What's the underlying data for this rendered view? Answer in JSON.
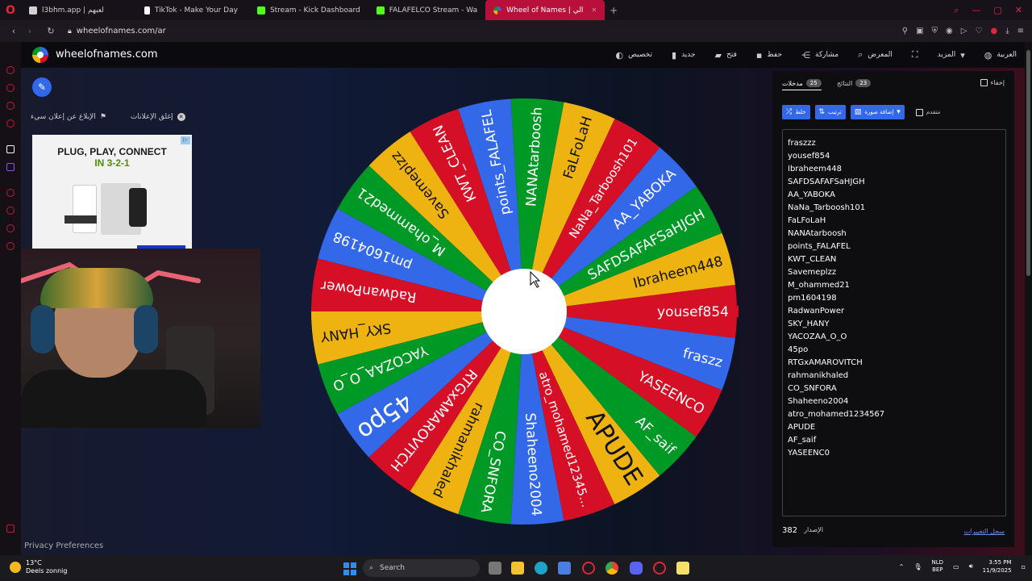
{
  "browser": {
    "tabs": [
      {
        "title": "l3bhm.app | لعبهم",
        "icon_color": "#d1d1d1",
        "active": false
      },
      {
        "title": "TikTok - Make Your Day",
        "icon_color": "#ffffff",
        "active": false
      },
      {
        "title": "Stream - Kick Dashboard",
        "icon_color": "#53fc18",
        "active": false
      },
      {
        "title": "FALAFELCO Stream - Wa",
        "icon_color": "#53fc18",
        "active": false
      },
      {
        "title": "Wheel of Names | الي",
        "icon_color": "#ffffff",
        "active": true
      }
    ],
    "url": "wheelofnames.com/ar"
  },
  "site": {
    "name": "wheelofnames.com",
    "menu": [
      {
        "label": "العربية",
        "icon": "globe-icon"
      },
      {
        "label": "المزيد",
        "icon": "chevron-down-icon"
      },
      {
        "label": "",
        "icon": "fullscreen-icon"
      },
      {
        "label": "المعرض",
        "icon": "search-icon"
      },
      {
        "label": "مشاركة",
        "icon": "share-icon"
      },
      {
        "label": "حفظ",
        "icon": "save-icon"
      },
      {
        "label": "فتح",
        "icon": "folder-icon"
      },
      {
        "label": "جديد",
        "icon": "file-icon"
      },
      {
        "label": "تخصيص",
        "icon": "palette-icon"
      }
    ],
    "ad_report": "الإبلاغ عن إعلان سيء",
    "ad_close": "إغلق الإعلانات",
    "ad_line1": "PLUG, PLAY, CONNECT",
    "ad_line2": "IN 3-2-1",
    "privacy": "Privacy Preferences"
  },
  "wheel": {
    "colors": [
      "#3369e8",
      "#d50f25",
      "#eeb211",
      "#009925"
    ],
    "pointer_color": "#d50f25",
    "segments": [
      "yousef854",
      "Ibraheem448",
      "SAFDSAFAFSaHJGH",
      "AA_YABOKA",
      "NaNa_Tarboosh101",
      "FaLFoLaH",
      "NANAtarboosh",
      "points_FALAFEL",
      "KWT_CLEAN",
      "Savemeplzz",
      "M_ohammed21",
      "pm1604198",
      "RadwanPower",
      "SKY_HANY",
      "YACOZAA_O_O",
      "45po",
      "RTGxAMAROVITCH",
      "rahmanikhaled",
      "CO_SNFORA",
      "Shaheeno2004",
      "atro_mohamed12345...",
      "APUDE",
      "AF_saif",
      "YASEENCO",
      "fraszz"
    ],
    "segment_colors": [
      "#d50f25",
      "#eeb211",
      "#009925",
      "#3369e8",
      "#d50f25",
      "#eeb211",
      "#009925",
      "#3369e8",
      "#d50f25",
      "#eeb211",
      "#009925",
      "#3369e8",
      "#d50f25",
      "#eeb211",
      "#009925",
      "#3369e8",
      "#d50f25",
      "#eeb211",
      "#009925",
      "#3369e8",
      "#d50f25",
      "#eeb211",
      "#009925",
      "#d50f25",
      "#3369e8"
    ]
  },
  "panel": {
    "entries_tab": "مدخلات",
    "entries_count": "25",
    "results_tab": "النتائج",
    "results_count": "23",
    "hide_label": "إخفاء",
    "shuffle": "خلط",
    "sort": "ترتيب",
    "add_image": "إضافة صورة",
    "advanced": "متقدم",
    "entries": [
      "fraszzz",
      "yousef854",
      "Ibraheem448",
      "SAFDSAFAFSaHJGH",
      "AA_YABOKA",
      "NaNa_Tarboosh101",
      "FaLFoLaH",
      "NANAtarboosh",
      "points_FALAFEL",
      "KWT_CLEAN",
      "Savemeplzz",
      "M_ohammed21",
      "pm1604198",
      "RadwanPower",
      "SKY_HANY",
      "YACOZAA_O_O",
      "45po",
      "RTGxAMAROVITCH",
      "rahmanikhaled",
      "CO_SNFORA",
      "Shaheeno2004",
      "atro_mohamed1234567",
      "APUDE",
      "AF_saif",
      "YASEENC0"
    ],
    "version_label": "الإصدار",
    "version_number": "382",
    "changelog": "سجل التغييرات"
  },
  "taskbar": {
    "temp": "13°C",
    "weather": "Deels zonnig",
    "search": "Search",
    "lang1": "NLD",
    "lang2": "BEP",
    "time": "3:55 PM",
    "date": "11/9/2025"
  }
}
